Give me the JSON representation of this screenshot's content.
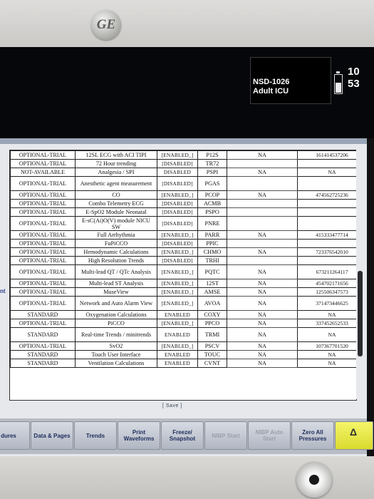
{
  "brand": {
    "logo": "GE"
  },
  "status": {
    "bed": "NSD-1026",
    "unit": "Adult ICU",
    "time": "10 53"
  },
  "side_label": "nt",
  "rows": [
    [
      "OPTIONAL-TRIAL",
      "12SL ECG with ACI TIPI",
      "[ENABLED_]",
      "P12S",
      "NA",
      "161414537206"
    ],
    [
      "OPTIONAL-TRIAL",
      "72 Hour trending",
      "[DISABLED]",
      "TR72",
      "",
      ""
    ],
    [
      "NOT-AVAILABLE",
      "Analgesia / SPI",
      "DISABLED",
      "PSPI",
      "NA",
      "NA"
    ],
    [
      "OPTIONAL-TRIAL",
      "Anesthetic agent measurement",
      "[DISABLED]",
      "PGAS",
      "",
      ""
    ],
    [
      "OPTIONAL-TRIAL",
      "CO",
      "[ENABLED_]",
      "PCOP",
      "NA",
      "474562725236"
    ],
    [
      "OPTIONAL-TRIAL",
      "Combo Telemetry ECG",
      "[DISABLED]",
      "ACMB",
      "",
      ""
    ],
    [
      "OPTIONAL-TRIAL",
      "E-SpO2 Module Neonatal",
      "[DISABLED]",
      "PSPO",
      "",
      ""
    ],
    [
      "OPTIONAL-TRIAL",
      "E-sC(Ai)O(V) module NICU SW",
      "[DISABLED]",
      "PNRE",
      "",
      ""
    ],
    [
      "OPTIONAL-TRIAL",
      "Full Arrhythmia",
      "[ENABLED_]",
      "PARR",
      "NA",
      "415333477714"
    ],
    [
      "OPTIONAL-TRIAL",
      "FuPiCCO",
      "[DISABLED]",
      "PPIC",
      "",
      ""
    ],
    [
      "OPTIONAL-TRIAL",
      "Hemodynamic Calculations",
      "[ENABLED_]",
      "CHMO",
      "NA",
      "723376542010"
    ],
    [
      "OPTIONAL-TRIAL",
      "High Resolution Trends",
      "[DISABLED]",
      "TRHI",
      "",
      ""
    ],
    [
      "OPTIONAL-TRIAL",
      "Multi-lead QT / QTc Analysis",
      "[ENABLED_]",
      "PQTC",
      "NA",
      "673211264117"
    ],
    [
      "OPTIONAL-TRIAL",
      "Multi-lead ST Analysis",
      "[ENABLED_]",
      "12ST",
      "NA",
      "454702171656"
    ],
    [
      "OPTIONAL-TRIAL",
      "MuseView",
      "[ENABLED_]",
      "AMSE",
      "NA",
      "125506347573"
    ],
    [
      "OPTIONAL-TRIAL",
      "Network and Auto Alarm View",
      "[ENABLED_]",
      "AVOA",
      "NA",
      "371473446625"
    ],
    [
      "STANDARD",
      "Oxygenation Calculations",
      "ENABLED",
      "COXY",
      "NA",
      "NA"
    ],
    [
      "OPTIONAL-TRIAL",
      "PiCCO",
      "[ENABLED_]",
      "PPCO",
      "NA",
      "337452652533"
    ],
    [
      "STANDARD",
      "Real-time Trends / minitrends",
      "ENABLED",
      "TRMI",
      "NA",
      "NA"
    ],
    [
      "OPTIONAL-TRIAL",
      "SvO2",
      "[ENABLED_]",
      "PSCV",
      "NA",
      "107367701520"
    ],
    [
      "STANDARD",
      "Touch User Interface",
      "ENABLED",
      "TOUC",
      "NA",
      "NA"
    ],
    [
      "STANDARD",
      "Ventilation Calculations",
      "ENABLED",
      "CVNT",
      "NA",
      "NA"
    ]
  ],
  "save_label": "[ Save ]",
  "softkeys": [
    {
      "label": "dures",
      "dim": false
    },
    {
      "label": "Data & Pages",
      "dim": false
    },
    {
      "label": "Trends",
      "dim": false
    },
    {
      "label": "Print Waveforms",
      "dim": false
    },
    {
      "label": "Freeze/ Snapshot",
      "dim": false
    },
    {
      "label": "NIBP Start",
      "dim": true
    },
    {
      "label": "NIBP Auto Start",
      "dim": true
    },
    {
      "label": "Zero All Pressures",
      "dim": false
    }
  ],
  "colors": {
    "alarm_key": "#e6e84a",
    "panel": "#e6e8ec",
    "status_bg": "#05070a"
  },
  "icons": {
    "alarm": "bell-icon",
    "battery": "battery-icon"
  }
}
